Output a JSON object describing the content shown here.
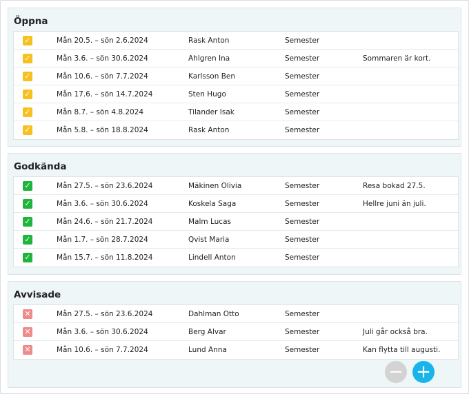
{
  "sections": {
    "open": {
      "title": "Öppna",
      "rows": [
        {
          "date": "Mån 20.5. – sön 2.6.2024",
          "name": "Rask Anton",
          "type": "Semester",
          "note": ""
        },
        {
          "date": "Mån 3.6. – sön 30.6.2024",
          "name": "Ahlgren Ina",
          "type": "Semester",
          "note": "Sommaren är kort."
        },
        {
          "date": "Mån 10.6. – sön 7.7.2024",
          "name": "Karlsson Ben",
          "type": "Semester",
          "note": ""
        },
        {
          "date": "Mån 17.6. – sön 14.7.2024",
          "name": "Sten Hugo",
          "type": "Semester",
          "note": ""
        },
        {
          "date": "Mån 8.7. – sön 4.8.2024",
          "name": "Tilander Isak",
          "type": "Semester",
          "note": ""
        },
        {
          "date": "Mån 5.8. – sön 18.8.2024",
          "name": "Rask Anton",
          "type": "Semester",
          "note": ""
        }
      ]
    },
    "approved": {
      "title": "Godkända",
      "rows": [
        {
          "date": "Mån 27.5. – sön 23.6.2024",
          "name": "Mäkinen Olivia",
          "type": "Semester",
          "note": "Resa bokad 27.5."
        },
        {
          "date": "Mån 3.6. – sön 30.6.2024",
          "name": "Koskela Saga",
          "type": "Semester",
          "note": "Hellre juni än juli."
        },
        {
          "date": "Mån 24.6. – sön 21.7.2024",
          "name": "Malm Lucas",
          "type": "Semester",
          "note": ""
        },
        {
          "date": "Mån 1.7. – sön 28.7.2024",
          "name": "Qvist Maria",
          "type": "Semester",
          "note": ""
        },
        {
          "date": "Mån 15.7. – sön 11.8.2024",
          "name": "Lindell Anton",
          "type": "Semester",
          "note": ""
        }
      ]
    },
    "rejected": {
      "title": "Avvisade",
      "rows": [
        {
          "date": "Mån 27.5. – sön 23.6.2024",
          "name": "Dahlman Otto",
          "type": "Semester",
          "note": ""
        },
        {
          "date": "Mån 3.6. – sön 30.6.2024",
          "name": "Berg Alvar",
          "type": "Semester",
          "note": "Juli går också bra."
        },
        {
          "date": "Mån 10.6. – sön 7.7.2024",
          "name": "Lund Anna",
          "type": "Semester",
          "note": "Kan flytta till augusti."
        }
      ]
    }
  },
  "icons": {
    "open_check": "check-icon",
    "approved_check": "check-icon",
    "rejected_mark": "cross-icon",
    "remove_button": "minus-icon",
    "add_button": "plus-icon"
  },
  "colors": {
    "open": "#f8c01e",
    "approved": "#1fb53c",
    "rejected": "#ee8a8a",
    "add_button": "#17b5ea",
    "remove_button": "#d3d3d3"
  },
  "buttons": {
    "remove_glyph": "−",
    "add_glyph": "+"
  }
}
